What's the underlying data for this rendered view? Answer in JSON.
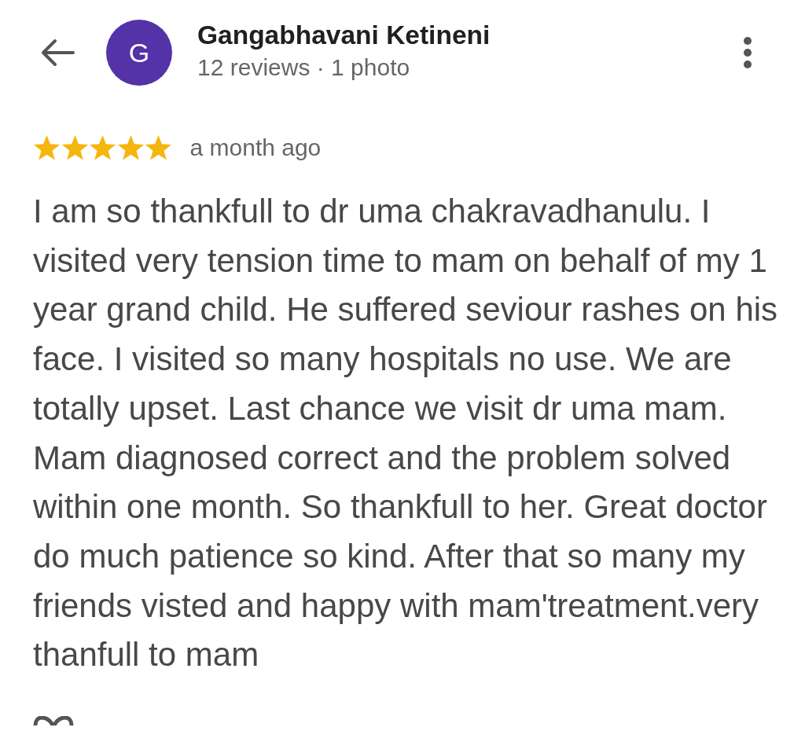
{
  "header": {
    "avatar_letter": "G",
    "name": "Gangabhavani Ketineni",
    "subtitle": "12 reviews · 1 photo"
  },
  "review": {
    "stars": 5,
    "time": "a month ago",
    "text": "I am so thankfull to dr uma chakravadhanulu. I visited very tension time to mam on behalf of my 1 year grand child. He suffered seviour rashes on his face. I visited so many hospitals no use. We are totally upset. Last chance we visit dr uma mam. Mam diagnosed correct and the problem solved within one month. So thankfull to her. Great doctor do much patience so kind. After that so many my friends visted and happy with mam'treatment.very thanfull to mam"
  }
}
